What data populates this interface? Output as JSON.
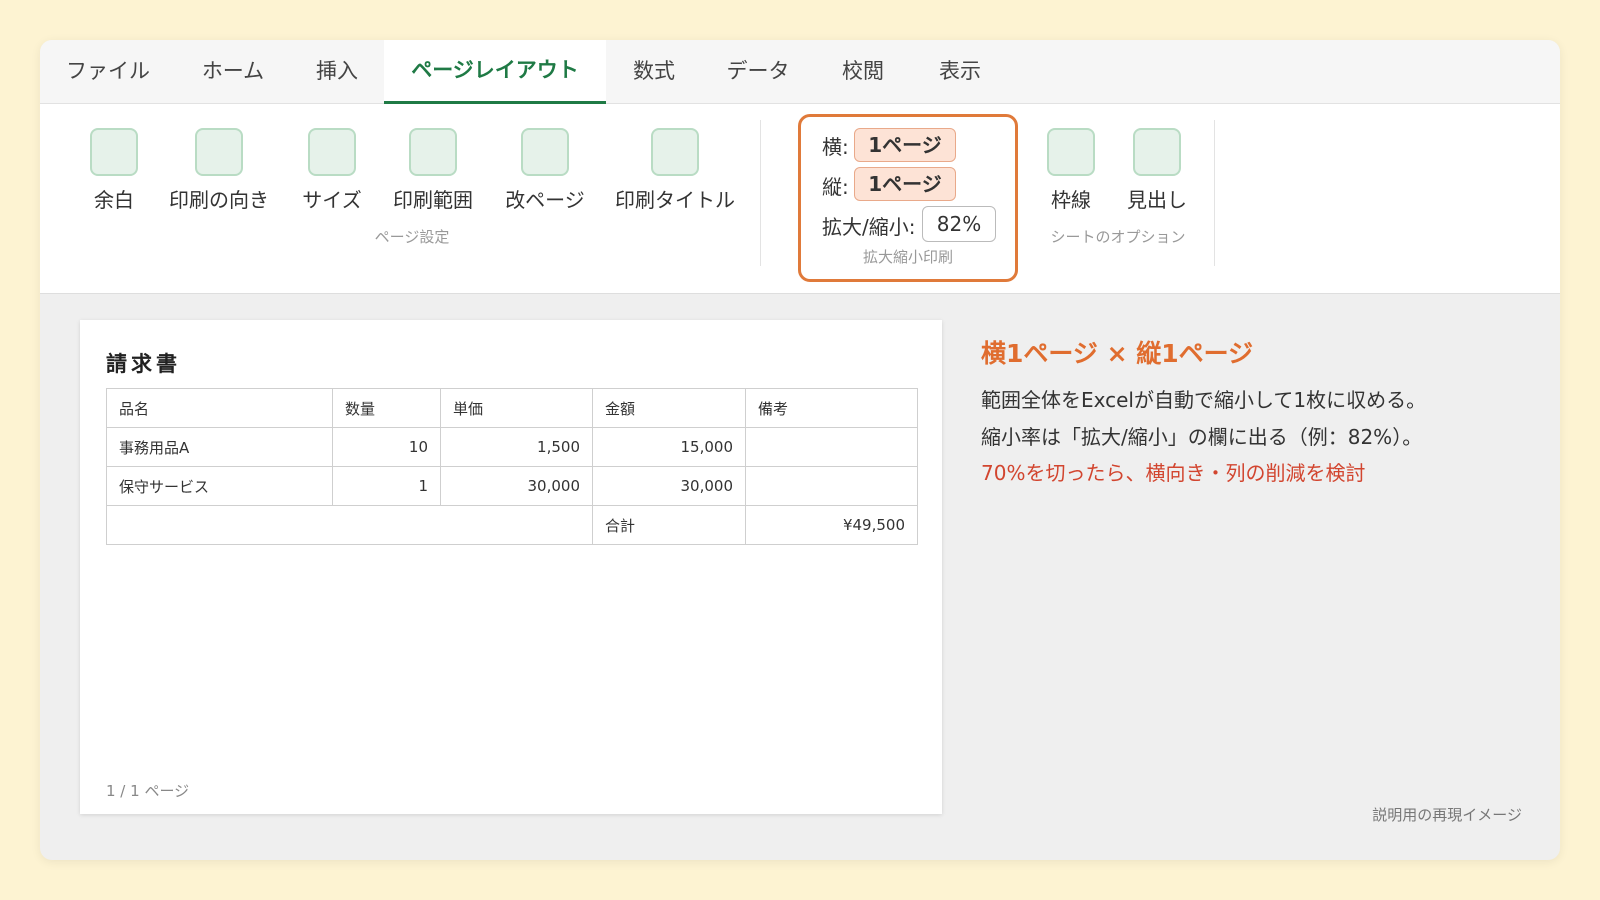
{
  "tabs": [
    {
      "label": "ファイル"
    },
    {
      "label": "ホーム"
    },
    {
      "label": "挿入"
    },
    {
      "label": "ページレイアウト"
    },
    {
      "label": "数式"
    },
    {
      "label": "データ"
    },
    {
      "label": "校閲"
    },
    {
      "label": "表示"
    }
  ],
  "active_tab": "ページレイアウト",
  "ribbon": {
    "page_setup": {
      "buttons": [
        {
          "label": "余白"
        },
        {
          "label": "印刷の向き"
        },
        {
          "label": "サイズ"
        },
        {
          "label": "印刷範囲"
        },
        {
          "label": "改ページ"
        },
        {
          "label": "印刷タイトル"
        }
      ],
      "group_label": "ページ設定"
    },
    "scale_to_fit": {
      "width_label": "横:",
      "width_value": "1ページ",
      "height_label": "縦:",
      "height_value": "1ページ",
      "zoom_label": "拡大/縮小:",
      "zoom_value": "82%",
      "group_label": "拡大縮小印刷"
    },
    "sheet_options": {
      "buttons": [
        {
          "label": "枠線"
        },
        {
          "label": "見出し"
        }
      ],
      "group_label": "シートのオプション"
    }
  },
  "sheet": {
    "title": "請求書",
    "columns": [
      "品名",
      "数量",
      "単価",
      "金額",
      "備考"
    ],
    "rows": [
      {
        "item": "事務用品A",
        "qty": "10",
        "price": "1,500",
        "amount": "15,000",
        "note": ""
      },
      {
        "item": "保守サービス",
        "qty": "1",
        "price": "30,000",
        "amount": "30,000",
        "note": ""
      }
    ],
    "total_label": "合計",
    "total_value": "¥49,500",
    "page_indicator": "1 / 1 ページ"
  },
  "explanation": {
    "title": "横1ページ × 縦1ページ",
    "line1": "範囲全体をExcelが自動で縮小して1枚に収める。",
    "line2": "縮小率は「拡大/縮小」の欄に出る（例：82%）。",
    "warning": "70%を切ったら、横向き・列の削減を検討"
  },
  "footnote": "説明用の再現イメージ",
  "colors": {
    "page_background": "#fdf3d2",
    "accent_green": "#1f7a45",
    "highlight_orange": "#e07a3a",
    "title_orange": "#e06d2f",
    "warning_red": "#d2452f",
    "icon_fill": "#e6f2ea"
  }
}
